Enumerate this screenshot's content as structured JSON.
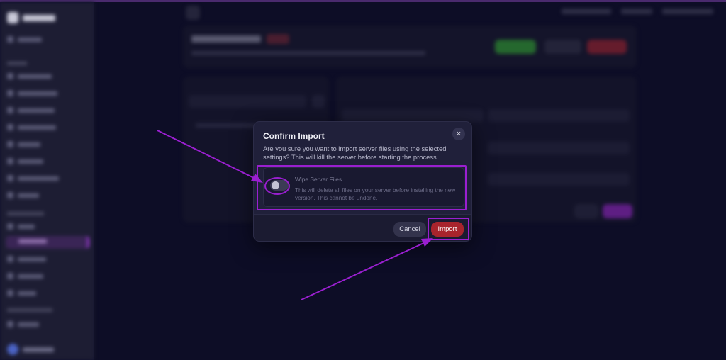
{
  "modal": {
    "title": "Confirm Import",
    "close_icon": "×",
    "description": "Are you sure you want to import server files using the selected settings? This will kill the server before starting the process.",
    "option": {
      "label": "Wipe Server Files",
      "description": "This will delete all files on your server before installing the new version. This cannot be undone.",
      "enabled": false
    },
    "cancel_label": "Cancel",
    "import_label": "Import"
  },
  "colors": {
    "annotation": "#9a1fd0",
    "import_button": "#a8242d",
    "background": "#0f0f2c"
  },
  "icons": {
    "close": "close-icon",
    "annotation_arrow": "arrow-icon"
  }
}
